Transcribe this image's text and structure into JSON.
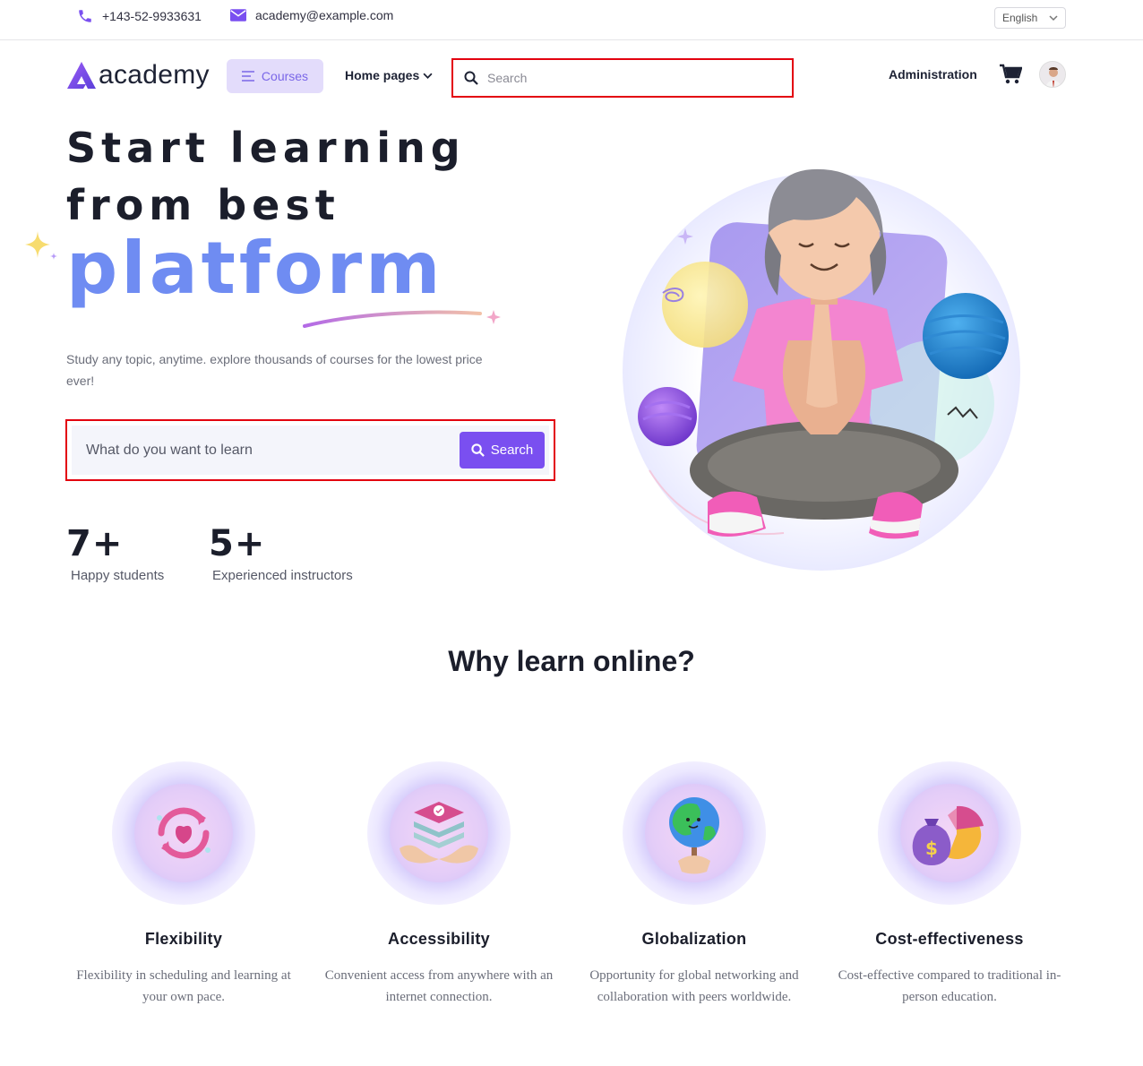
{
  "topbar": {
    "phone": "+143-52-9933631",
    "email": "academy@example.com",
    "language": "English"
  },
  "nav": {
    "logo_text": "academy",
    "courses_label": "Courses",
    "home_pages_label": "Home pages",
    "search_placeholder": "Search",
    "admin_label": "Administration"
  },
  "hero": {
    "title_line1": "Start learning",
    "title_line2": "from best",
    "title_accent": "platform",
    "subtitle": "Study any topic, anytime. explore thousands of courses for the lowest price ever!",
    "search_placeholder": "What do you want to learn",
    "search_button": "Search"
  },
  "stats": [
    {
      "value": "7+",
      "label": "Happy students"
    },
    {
      "value": "5+",
      "label": "Experienced instructors"
    }
  ],
  "why": {
    "title": "Why learn online?",
    "features": [
      {
        "title": "Flexibility",
        "text": "Flexibility in scheduling and learning at your own pace.",
        "icon": "flexibility-icon"
      },
      {
        "title": "Accessibility",
        "text": "Convenient access from anywhere with an internet connection.",
        "icon": "accessibility-icon"
      },
      {
        "title": "Globalization",
        "text": "Opportunity for global networking and collaboration with peers worldwide.",
        "icon": "globe-icon"
      },
      {
        "title": "Cost-effectiveness",
        "text": "Cost-effective compared to traditional in-person education.",
        "icon": "money-chart-icon"
      }
    ]
  },
  "colors": {
    "brand": "#7a4ff0",
    "accent_text": "#6f8cf2",
    "highlight_border": "#e3000f"
  }
}
